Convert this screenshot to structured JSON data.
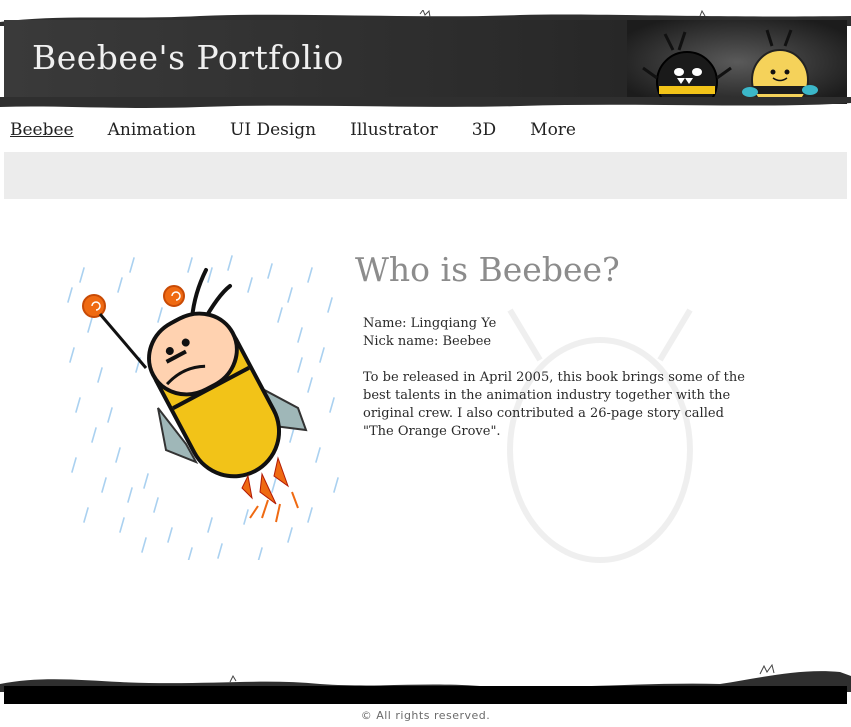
{
  "header": {
    "title": "Beebee's Portfolio"
  },
  "nav": {
    "items": [
      {
        "label": "Beebee",
        "active": true
      },
      {
        "label": "Animation",
        "active": false
      },
      {
        "label": "UI Design",
        "active": false
      },
      {
        "label": "Illustrator",
        "active": false
      },
      {
        "label": "3D",
        "active": false
      },
      {
        "label": "More",
        "active": false
      }
    ]
  },
  "main": {
    "heading": "Who is Beebee?",
    "name_line": "Name: Lingqiang Ye",
    "nick_line": "Nick name: Beebee",
    "description": "To be released in April 2005, this book brings some of the best talents in the animation industry together with the original crew. I also contributed a 26-page story called \"The Orange Grove\"."
  },
  "footer": {
    "copyright": "© All rights reserved."
  },
  "colors": {
    "header_bg": "#2b2b2b",
    "subbar_bg": "#ececec",
    "heading": "#8c8c8c",
    "footer_bg": "#000000",
    "bee_yellow": "#f2c318",
    "bee_orange": "#ef6a12"
  },
  "icons": {
    "header_art": "bee-characters-icon",
    "illustration": "flying-bee-icon"
  }
}
